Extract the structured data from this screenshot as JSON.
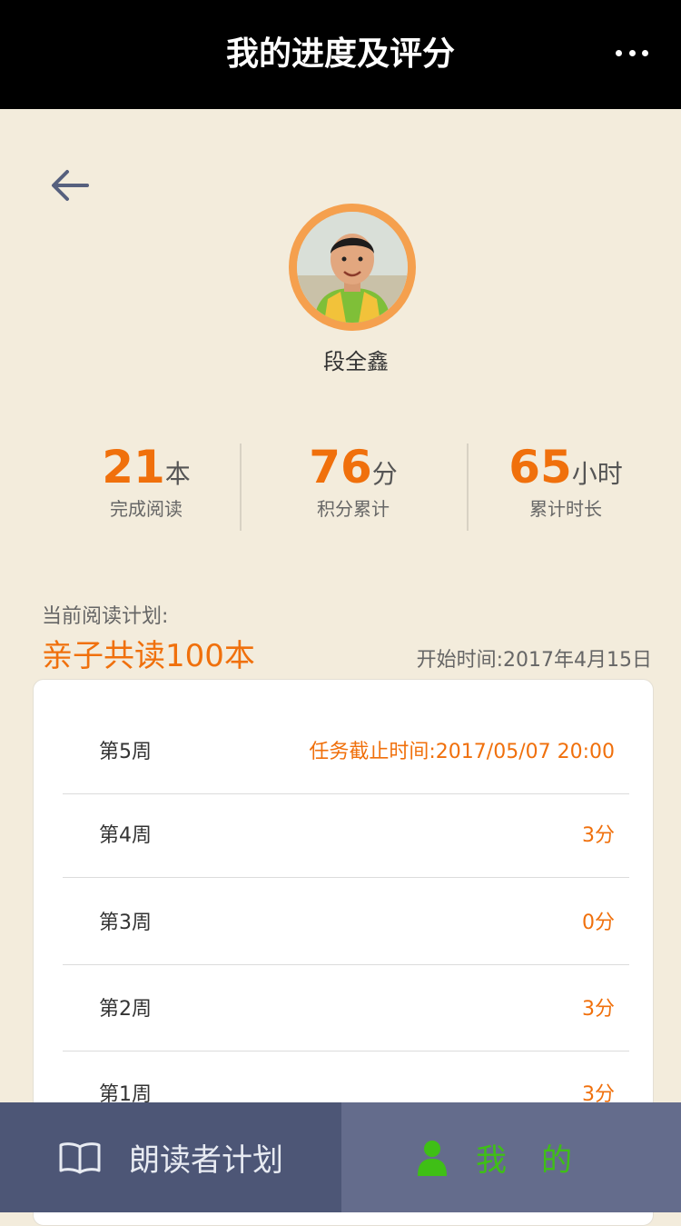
{
  "navbar": {
    "title": "我的进度及评分",
    "more_icon": "more-dots-icon"
  },
  "profile": {
    "name": "段全鑫"
  },
  "stats": [
    {
      "value": "21",
      "unit": "本",
      "label": "完成阅读"
    },
    {
      "value": "76",
      "unit": "分",
      "label": "积分累计"
    },
    {
      "value": "65",
      "unit": "小时",
      "label": "累计时长"
    }
  ],
  "plan": {
    "label": "当前阅读计划:",
    "name": "亲子共读100本",
    "start_time": "开始时间:2017年4月15日"
  },
  "weeks": [
    {
      "week": "第5周",
      "score": "任务截止时间:2017/05/07  20:00"
    },
    {
      "week": "第4周",
      "score": "3分"
    },
    {
      "week": "第3周",
      "score": "0分"
    },
    {
      "week": "第2周",
      "score": "3分"
    },
    {
      "week": "第1周",
      "score": "3分"
    }
  ],
  "tabbar": {
    "plan_label": "朗读者计划",
    "me_label": "我的"
  },
  "colors": {
    "accent": "#f0700c",
    "tab_active": "#3fbf16",
    "ring": "#f5a04e"
  }
}
